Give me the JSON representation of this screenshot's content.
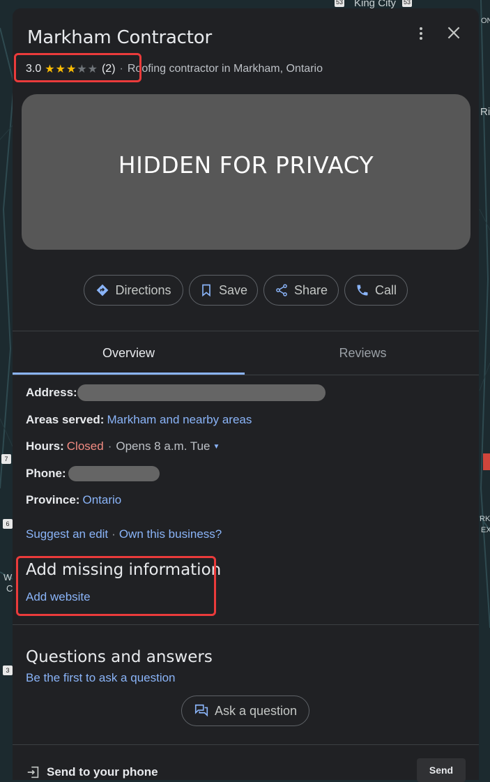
{
  "map": {
    "labels": [
      "King City",
      "Ri",
      "ON",
      "W",
      "C",
      "RKD",
      "EX"
    ],
    "shields": [
      "53",
      "6",
      "3",
      "7"
    ]
  },
  "place": {
    "name": "Markham Contractor",
    "rating": "3.0",
    "stars_filled": 3,
    "stars_total": 5,
    "review_count": "(2)",
    "category": "Roofing contractor in Markham, Ontario",
    "photo_placeholder": "HIDDEN FOR PRIVACY"
  },
  "actions": {
    "directions": "Directions",
    "save": "Save",
    "share": "Share",
    "call": "Call"
  },
  "tabs": {
    "overview": "Overview",
    "reviews": "Reviews"
  },
  "info": {
    "address_label": "Address:",
    "areas_label": "Areas served:",
    "areas_value": "Markham and nearby areas",
    "hours_label": "Hours:",
    "hours_status": "Closed",
    "hours_next": "Opens 8 a.m. Tue",
    "phone_label": "Phone:",
    "province_label": "Province:",
    "province_value": "Ontario",
    "suggest_edit": "Suggest an edit",
    "own_business": "Own this business?"
  },
  "missing": {
    "title": "Add missing information",
    "add_website": "Add website"
  },
  "qa": {
    "title": "Questions and answers",
    "prompt": "Be the first to ask a question",
    "ask_button": "Ask a question"
  },
  "send": {
    "label": "Send to your phone",
    "button": "Send"
  },
  "colors": {
    "panel": "#202124",
    "accent": "#8ab4f8",
    "star": "#fbbc04",
    "closed": "#f28b82",
    "highlight_box": "#ea3b3b"
  }
}
